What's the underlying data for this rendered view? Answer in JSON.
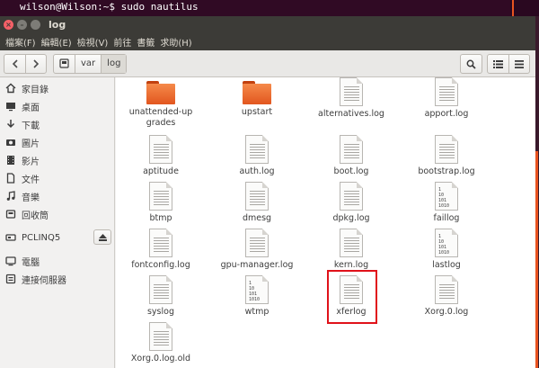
{
  "terminal": {
    "prompt": "wilson@Wilson:~$ sudo nautilus"
  },
  "window": {
    "title": "log"
  },
  "menubar": [
    "檔案(F)",
    "編輯(E)",
    "檢視(V)",
    "前往",
    "書籤",
    "求助(H)"
  ],
  "toolbar": {
    "back_icon": "chevron-left-icon",
    "forward_icon": "chevron-right-icon",
    "breadcrumbs": [
      "var",
      "log"
    ]
  },
  "sidebar": {
    "places": [
      {
        "label": "家目錄",
        "icon": "home-icon"
      },
      {
        "label": "桌面",
        "icon": "desktop-icon"
      },
      {
        "label": "下載",
        "icon": "download-icon"
      },
      {
        "label": "圖片",
        "icon": "camera-icon"
      },
      {
        "label": "影片",
        "icon": "film-icon"
      },
      {
        "label": "文件",
        "icon": "document-icon"
      },
      {
        "label": "音樂",
        "icon": "music-icon"
      },
      {
        "label": "回收筒",
        "icon": "trash-icon"
      }
    ],
    "devices": [
      {
        "label": "PCLINQ5",
        "icon": "drive-icon"
      }
    ],
    "network": [
      {
        "label": "電腦",
        "icon": "computer-icon"
      },
      {
        "label": "連接伺服器",
        "icon": "server-icon"
      }
    ]
  },
  "files": [
    {
      "name": "unattended-upgrades",
      "type": "folder"
    },
    {
      "name": "upstart",
      "type": "folder"
    },
    {
      "name": "alternatives.log",
      "type": "text"
    },
    {
      "name": "apport.log",
      "type": "text"
    },
    {
      "name": "aptitude",
      "type": "text"
    },
    {
      "name": "auth.log",
      "type": "text"
    },
    {
      "name": "boot.log",
      "type": "text"
    },
    {
      "name": "bootstrap.log",
      "type": "text"
    },
    {
      "name": "btmp",
      "type": "text"
    },
    {
      "name": "dmesg",
      "type": "text"
    },
    {
      "name": "dpkg.log",
      "type": "text"
    },
    {
      "name": "faillog",
      "type": "binary"
    },
    {
      "name": "fontconfig.log",
      "type": "text"
    },
    {
      "name": "gpu-manager.log",
      "type": "text"
    },
    {
      "name": "kern.log",
      "type": "text"
    },
    {
      "name": "lastlog",
      "type": "binary"
    },
    {
      "name": "syslog",
      "type": "text"
    },
    {
      "name": "wtmp",
      "type": "binary"
    },
    {
      "name": "xferlog",
      "type": "text",
      "highlighted": true
    },
    {
      "name": "Xorg.0.log",
      "type": "text"
    },
    {
      "name": "Xorg.0.log.old",
      "type": "text"
    }
  ],
  "binary_glyph": [
    "1",
    "10",
    "101",
    "1010"
  ],
  "colors": {
    "highlight": "#e0121a",
    "folder": "#e2561f",
    "accent": "#e95420"
  }
}
